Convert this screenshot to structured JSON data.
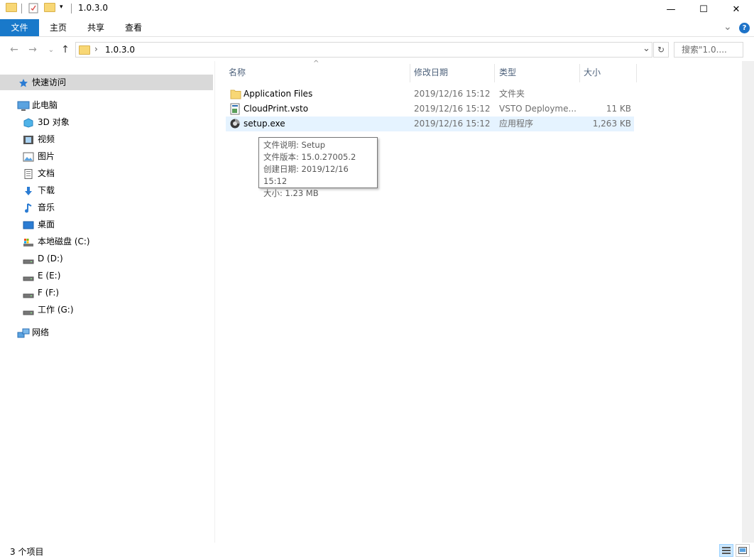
{
  "window": {
    "title": "1.0.3.0",
    "minimize_glyph": "—",
    "maximize_glyph": "☐",
    "close_glyph": "✕"
  },
  "ribbon": {
    "tabs": [
      {
        "label": "文件"
      },
      {
        "label": "主页"
      },
      {
        "label": "共享"
      },
      {
        "label": "查看"
      }
    ],
    "expand_glyph": "⌄",
    "help_glyph": "?"
  },
  "address": {
    "breadcrumb": "1.0.3.0",
    "search_placeholder": "搜索\"1.0....",
    "back_glyph": "←",
    "forward_glyph": "→",
    "up_glyph": "↑",
    "recent_glyph": "⌄",
    "dropdown_glyph": "⌄",
    "refresh_glyph": "↻",
    "chevron_glyph": "›"
  },
  "nav": {
    "quick_access": "快速访问",
    "this_pc": "此电脑",
    "pc_items": [
      {
        "label": "3D 对象",
        "icon": "3d-objects-icon"
      },
      {
        "label": "视频",
        "icon": "videos-icon"
      },
      {
        "label": "图片",
        "icon": "pictures-icon"
      },
      {
        "label": "文档",
        "icon": "documents-icon"
      },
      {
        "label": "下载",
        "icon": "downloads-icon"
      },
      {
        "label": "音乐",
        "icon": "music-icon"
      },
      {
        "label": "桌面",
        "icon": "desktop-icon"
      },
      {
        "label": "本地磁盘 (C:)",
        "icon": "system-drive-icon"
      },
      {
        "label": "D (D:)",
        "icon": "drive-icon"
      },
      {
        "label": "E (E:)",
        "icon": "drive-icon"
      },
      {
        "label": "F (F:)",
        "icon": "drive-icon"
      },
      {
        "label": "工作 (G:)",
        "icon": "drive-icon"
      }
    ],
    "network": "网络"
  },
  "columns": {
    "name": "名称",
    "date": "修改日期",
    "type": "类型",
    "size": "大小",
    "sort_glyph": "^"
  },
  "files": [
    {
      "name": "Application Files",
      "date": "2019/12/16 15:12",
      "type": "文件夹",
      "size": "",
      "icon": "folder-icon"
    },
    {
      "name": "CloudPrint.vsto",
      "date": "2019/12/16 15:12",
      "type": "VSTO Deployme...",
      "size": "11 KB",
      "icon": "vsto-file-icon"
    },
    {
      "name": "setup.exe",
      "date": "2019/12/16 15:12",
      "type": "应用程序",
      "size": "1,263 KB",
      "icon": "setup-exe-icon"
    }
  ],
  "tooltip": {
    "lines": [
      "文件说明: Setup",
      "文件版本: 15.0.27005.2",
      "创建日期: 2019/12/16 15:12",
      "大小: 1.23 MB"
    ]
  },
  "status": {
    "item_count": "3 个项目"
  },
  "colors": {
    "accent": "#1979ca",
    "selection": "#e5f3ff",
    "folder": "#f8d775"
  }
}
